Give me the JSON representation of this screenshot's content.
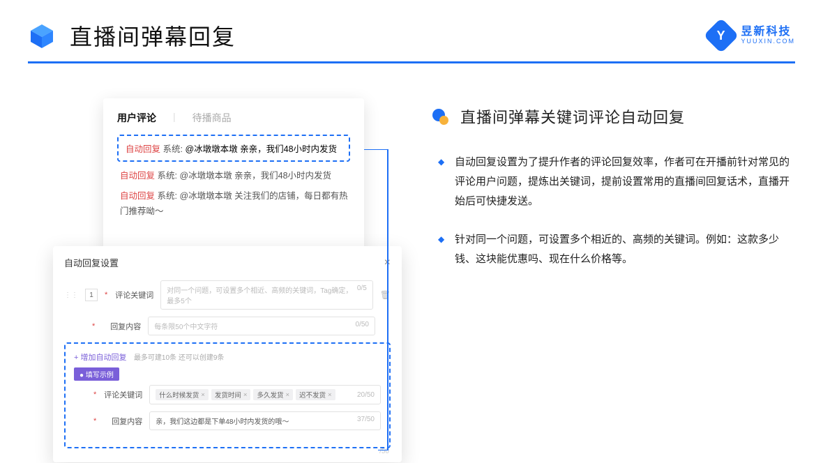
{
  "header": {
    "title": "直播间弹幕回复",
    "brand_name": "昱新科技",
    "brand_url": "YUUXIN.COM"
  },
  "card1": {
    "tab_active": "用户评论",
    "tab_inactive": "待播商品",
    "auto_tag": "自动回复",
    "sys_tag": "系统:",
    "reply1": "@冰墩墩本墩 亲亲，我们48小时内发货",
    "reply2": "@冰墩墩本墩 亲亲，我们48小时内发货",
    "reply3": "@冰墩墩本墩 关注我们的店铺，每日都有热门推荐呦～"
  },
  "card2": {
    "title": "自动回复设置",
    "num": "1",
    "lbl_keyword": "评论关键词",
    "ph_keyword": "对同一个问题，可设置多个相近、高频的关键词，Tag确定，最多5个",
    "count_keyword": "0/5",
    "lbl_content": "回复内容",
    "ph_content": "每条限50个中文字符",
    "count_content": "0/50",
    "add_link": "+ 增加自动回复",
    "add_hint": "最多可建10条 还可以创建9条",
    "pill": "● 填写示例",
    "tags": [
      "什么时候发货",
      "发货时间",
      "多久发货",
      "迟不发货"
    ],
    "tags_count": "20/50",
    "example_reply": "亲，我们这边都是下单48小时内发货的哦～",
    "example_count": "37/50",
    "bottom_count": "/50"
  },
  "right": {
    "section_title": "直播间弹幕关键词评论自动回复",
    "bullet1": "自动回复设置为了提升作者的评论回复效率，作者可在开播前针对常见的评论用户问题，提炼出关键词，提前设置常用的直播间回复话术，直播开始后可快捷发送。",
    "bullet2": "针对同一个问题，可设置多个相近的、高频的关键词。例如：这款多少钱、这块能优惠吗、现在什么价格等。"
  }
}
